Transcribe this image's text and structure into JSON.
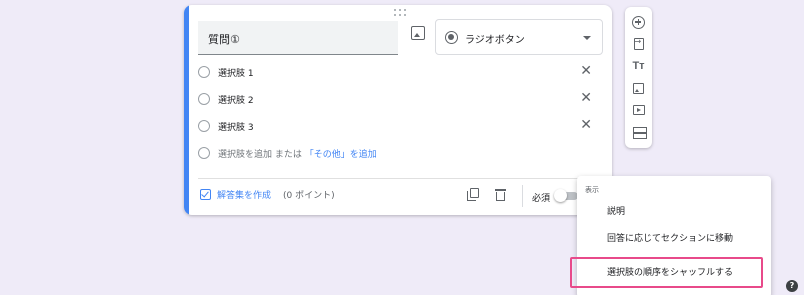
{
  "question": {
    "title": "質問①"
  },
  "type_select": {
    "selected": "ラジオボタン"
  },
  "options": [
    {
      "label": "選択肢 1"
    },
    {
      "label": "選択肢 2"
    },
    {
      "label": "選択肢 3"
    }
  ],
  "add_option": {
    "label": "選択肢を追加",
    "or": "または",
    "other_link": "「その他」を追加"
  },
  "footer": {
    "answer_key": "解答集を作成",
    "points": "(0 ポイント)",
    "required": "必須"
  },
  "menu": {
    "header": "表示",
    "items": [
      "説明",
      "回答に応じてセクションに移動",
      "選択肢の順序をシャッフルする"
    ]
  },
  "toolbar": {
    "title_icon_text": "Tт"
  },
  "help": {
    "label": "?"
  },
  "colors": {
    "accent": "#4285f4",
    "highlight": "#e84a8a",
    "background": "#efebf8"
  }
}
